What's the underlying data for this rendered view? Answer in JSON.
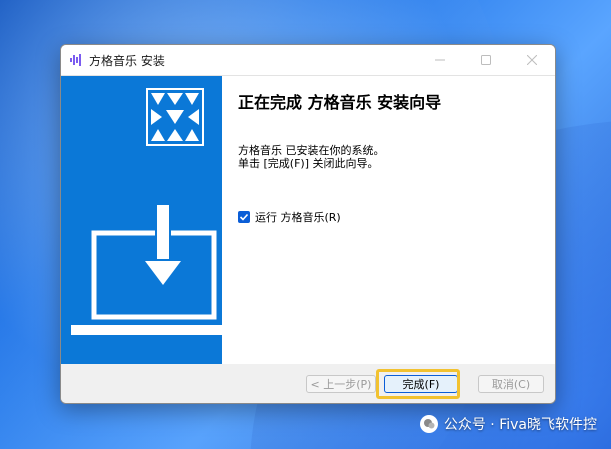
{
  "window": {
    "title": "方格音乐 安装",
    "controls": [
      "minimize",
      "maximize",
      "close"
    ]
  },
  "wizard": {
    "heading": "正在完成 方格音乐 安装向导",
    "line1": "方格音乐 已安装在你的系统。",
    "line2": "单击 [完成(F)] 关闭此向导。",
    "run_label": "运行 方格音乐(R)",
    "run_checked": true
  },
  "buttons": {
    "back": "< 上一步(P)",
    "finish": "完成(F)",
    "cancel": "取消(C)"
  },
  "watermark": "公众号 · Fiva晓飞软件控",
  "colors": {
    "sidebar": "#0b78d7",
    "highlight": "#f2c230"
  }
}
